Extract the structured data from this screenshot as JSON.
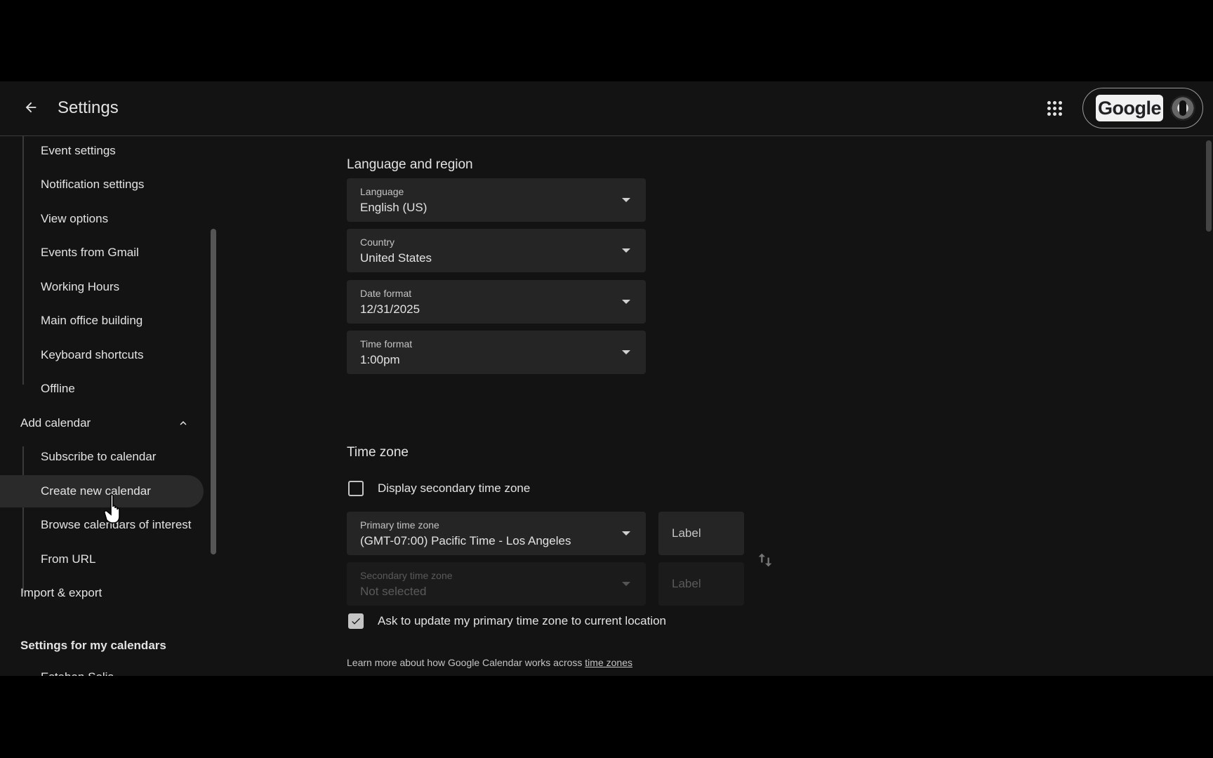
{
  "header": {
    "title": "Settings",
    "account_logo": "Google"
  },
  "sidebar": {
    "general_items": [
      {
        "label": "Event settings"
      },
      {
        "label": "Notification settings"
      },
      {
        "label": "View options"
      },
      {
        "label": "Events from Gmail"
      },
      {
        "label": "Working Hours"
      },
      {
        "label": "Main office building"
      },
      {
        "label": "Keyboard shortcuts"
      },
      {
        "label": "Offline"
      }
    ],
    "add_calendar": {
      "label": "Add calendar",
      "items": [
        {
          "label": "Subscribe to calendar"
        },
        {
          "label": "Create new calendar",
          "active": true
        },
        {
          "label": "Browse calendars of interest"
        },
        {
          "label": "From URL"
        }
      ]
    },
    "import_export": "Import & export",
    "my_calendars_title": "Settings for my calendars",
    "partial_item": "Esteban Solis"
  },
  "language_region": {
    "title": "Language and region",
    "fields": [
      {
        "label": "Language",
        "value": "English (US)"
      },
      {
        "label": "Country",
        "value": "United States"
      },
      {
        "label": "Date format",
        "value": "12/31/2025"
      },
      {
        "label": "Time format",
        "value": "1:00pm"
      }
    ]
  },
  "time_zone": {
    "title": "Time zone",
    "display_secondary_label": "Display secondary time zone",
    "display_secondary_checked": false,
    "primary": {
      "label": "Primary time zone",
      "value": "(GMT-07:00) Pacific Time - Los Angeles",
      "label_placeholder": "Label"
    },
    "secondary": {
      "label": "Secondary time zone",
      "value": "Not selected",
      "label_placeholder": "Label",
      "disabled": true
    },
    "ask_update_label": "Ask to update my primary time zone to current location",
    "ask_update_checked": true,
    "learn_more_text": "Learn more about how Google Calendar works across ",
    "learn_more_link": "time zones"
  },
  "colors": {
    "background": "#131313",
    "field": "#252525",
    "active_item": "#2a2a2a",
    "text": "#e3e3e3"
  }
}
